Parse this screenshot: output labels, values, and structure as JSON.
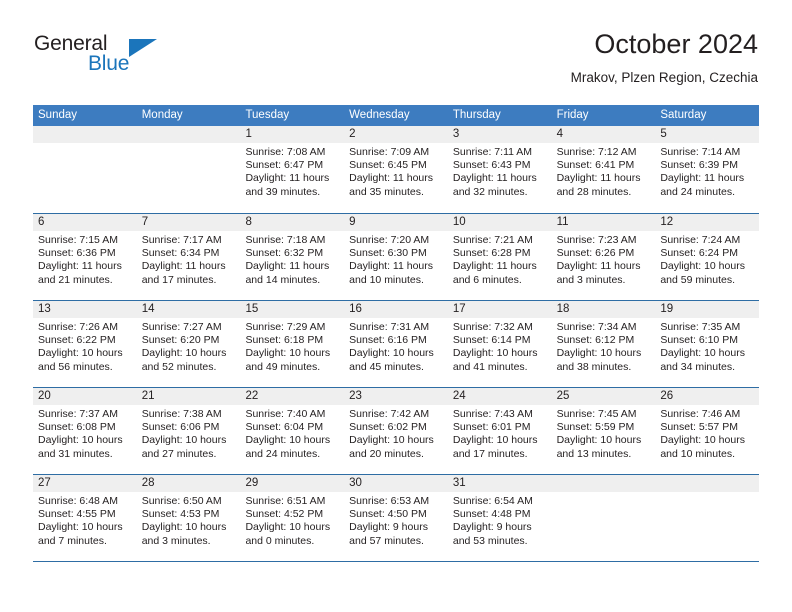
{
  "brand": {
    "name_top": "General",
    "name_bottom": "Blue",
    "triangle_color": "#1b75bb"
  },
  "header": {
    "month_title": "October 2024",
    "location": "Mrakov, Plzen Region, Czechia"
  },
  "theme": {
    "header_blue": "#3d7cc0",
    "rule_blue": "#2e6da4",
    "day_band_gray": "#efefef"
  },
  "weekdays": [
    "Sunday",
    "Monday",
    "Tuesday",
    "Wednesday",
    "Thursday",
    "Friday",
    "Saturday"
  ],
  "weeks": [
    [
      {
        "day": "",
        "sunrise": "",
        "sunset": "",
        "daylight": ""
      },
      {
        "day": "",
        "sunrise": "",
        "sunset": "",
        "daylight": ""
      },
      {
        "day": "1",
        "sunrise": "Sunrise: 7:08 AM",
        "sunset": "Sunset: 6:47 PM",
        "daylight": "Daylight: 11 hours and 39 minutes."
      },
      {
        "day": "2",
        "sunrise": "Sunrise: 7:09 AM",
        "sunset": "Sunset: 6:45 PM",
        "daylight": "Daylight: 11 hours and 35 minutes."
      },
      {
        "day": "3",
        "sunrise": "Sunrise: 7:11 AM",
        "sunset": "Sunset: 6:43 PM",
        "daylight": "Daylight: 11 hours and 32 minutes."
      },
      {
        "day": "4",
        "sunrise": "Sunrise: 7:12 AM",
        "sunset": "Sunset: 6:41 PM",
        "daylight": "Daylight: 11 hours and 28 minutes."
      },
      {
        "day": "5",
        "sunrise": "Sunrise: 7:14 AM",
        "sunset": "Sunset: 6:39 PM",
        "daylight": "Daylight: 11 hours and 24 minutes."
      }
    ],
    [
      {
        "day": "6",
        "sunrise": "Sunrise: 7:15 AM",
        "sunset": "Sunset: 6:36 PM",
        "daylight": "Daylight: 11 hours and 21 minutes."
      },
      {
        "day": "7",
        "sunrise": "Sunrise: 7:17 AM",
        "sunset": "Sunset: 6:34 PM",
        "daylight": "Daylight: 11 hours and 17 minutes."
      },
      {
        "day": "8",
        "sunrise": "Sunrise: 7:18 AM",
        "sunset": "Sunset: 6:32 PM",
        "daylight": "Daylight: 11 hours and 14 minutes."
      },
      {
        "day": "9",
        "sunrise": "Sunrise: 7:20 AM",
        "sunset": "Sunset: 6:30 PM",
        "daylight": "Daylight: 11 hours and 10 minutes."
      },
      {
        "day": "10",
        "sunrise": "Sunrise: 7:21 AM",
        "sunset": "Sunset: 6:28 PM",
        "daylight": "Daylight: 11 hours and 6 minutes."
      },
      {
        "day": "11",
        "sunrise": "Sunrise: 7:23 AM",
        "sunset": "Sunset: 6:26 PM",
        "daylight": "Daylight: 11 hours and 3 minutes."
      },
      {
        "day": "12",
        "sunrise": "Sunrise: 7:24 AM",
        "sunset": "Sunset: 6:24 PM",
        "daylight": "Daylight: 10 hours and 59 minutes."
      }
    ],
    [
      {
        "day": "13",
        "sunrise": "Sunrise: 7:26 AM",
        "sunset": "Sunset: 6:22 PM",
        "daylight": "Daylight: 10 hours and 56 minutes."
      },
      {
        "day": "14",
        "sunrise": "Sunrise: 7:27 AM",
        "sunset": "Sunset: 6:20 PM",
        "daylight": "Daylight: 10 hours and 52 minutes."
      },
      {
        "day": "15",
        "sunrise": "Sunrise: 7:29 AM",
        "sunset": "Sunset: 6:18 PM",
        "daylight": "Daylight: 10 hours and 49 minutes."
      },
      {
        "day": "16",
        "sunrise": "Sunrise: 7:31 AM",
        "sunset": "Sunset: 6:16 PM",
        "daylight": "Daylight: 10 hours and 45 minutes."
      },
      {
        "day": "17",
        "sunrise": "Sunrise: 7:32 AM",
        "sunset": "Sunset: 6:14 PM",
        "daylight": "Daylight: 10 hours and 41 minutes."
      },
      {
        "day": "18",
        "sunrise": "Sunrise: 7:34 AM",
        "sunset": "Sunset: 6:12 PM",
        "daylight": "Daylight: 10 hours and 38 minutes."
      },
      {
        "day": "19",
        "sunrise": "Sunrise: 7:35 AM",
        "sunset": "Sunset: 6:10 PM",
        "daylight": "Daylight: 10 hours and 34 minutes."
      }
    ],
    [
      {
        "day": "20",
        "sunrise": "Sunrise: 7:37 AM",
        "sunset": "Sunset: 6:08 PM",
        "daylight": "Daylight: 10 hours and 31 minutes."
      },
      {
        "day": "21",
        "sunrise": "Sunrise: 7:38 AM",
        "sunset": "Sunset: 6:06 PM",
        "daylight": "Daylight: 10 hours and 27 minutes."
      },
      {
        "day": "22",
        "sunrise": "Sunrise: 7:40 AM",
        "sunset": "Sunset: 6:04 PM",
        "daylight": "Daylight: 10 hours and 24 minutes."
      },
      {
        "day": "23",
        "sunrise": "Sunrise: 7:42 AM",
        "sunset": "Sunset: 6:02 PM",
        "daylight": "Daylight: 10 hours and 20 minutes."
      },
      {
        "day": "24",
        "sunrise": "Sunrise: 7:43 AM",
        "sunset": "Sunset: 6:01 PM",
        "daylight": "Daylight: 10 hours and 17 minutes."
      },
      {
        "day": "25",
        "sunrise": "Sunrise: 7:45 AM",
        "sunset": "Sunset: 5:59 PM",
        "daylight": "Daylight: 10 hours and 13 minutes."
      },
      {
        "day": "26",
        "sunrise": "Sunrise: 7:46 AM",
        "sunset": "Sunset: 5:57 PM",
        "daylight": "Daylight: 10 hours and 10 minutes."
      }
    ],
    [
      {
        "day": "27",
        "sunrise": "Sunrise: 6:48 AM",
        "sunset": "Sunset: 4:55 PM",
        "daylight": "Daylight: 10 hours and 7 minutes."
      },
      {
        "day": "28",
        "sunrise": "Sunrise: 6:50 AM",
        "sunset": "Sunset: 4:53 PM",
        "daylight": "Daylight: 10 hours and 3 minutes."
      },
      {
        "day": "29",
        "sunrise": "Sunrise: 6:51 AM",
        "sunset": "Sunset: 4:52 PM",
        "daylight": "Daylight: 10 hours and 0 minutes."
      },
      {
        "day": "30",
        "sunrise": "Sunrise: 6:53 AM",
        "sunset": "Sunset: 4:50 PM",
        "daylight": "Daylight: 9 hours and 57 minutes."
      },
      {
        "day": "31",
        "sunrise": "Sunrise: 6:54 AM",
        "sunset": "Sunset: 4:48 PM",
        "daylight": "Daylight: 9 hours and 53 minutes."
      },
      {
        "day": "",
        "sunrise": "",
        "sunset": "",
        "daylight": ""
      },
      {
        "day": "",
        "sunrise": "",
        "sunset": "",
        "daylight": ""
      }
    ]
  ]
}
